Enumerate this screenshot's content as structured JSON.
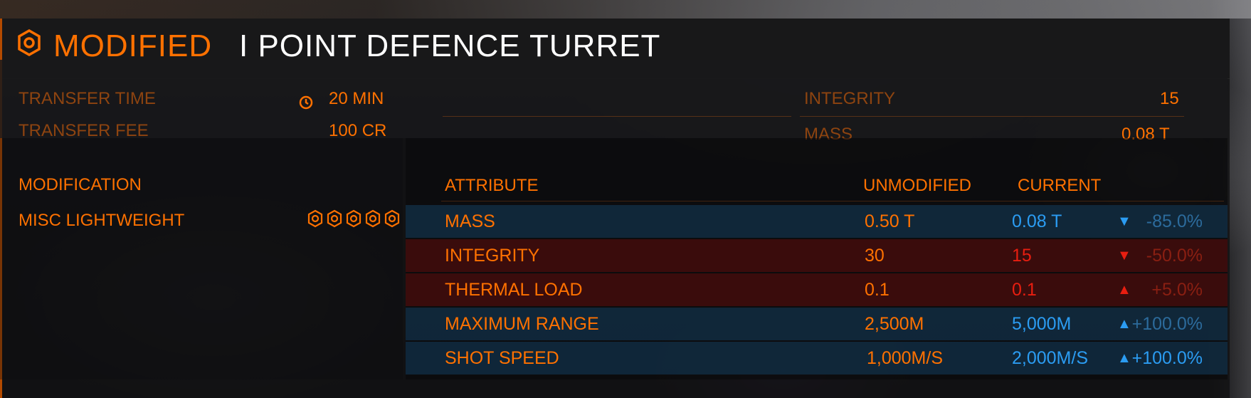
{
  "header": {
    "status": "MODIFIED",
    "title": "I POINT DEFENCE TURRET"
  },
  "transfer": {
    "time_label": "TRANSFER TIME",
    "time_value": "20 MIN",
    "fee_label": "TRANSFER FEE",
    "fee_value": "100 CR",
    "integrity_label": "INTEGRITY",
    "integrity_value": "15",
    "mass_label": "MASS",
    "mass_value": "0.08 T"
  },
  "modification": {
    "header": "MODIFICATION",
    "name": "MISC LIGHTWEIGHT",
    "grade": 5
  },
  "table": {
    "headers": {
      "attribute": "ATTRIBUTE",
      "unmodified": "UNMODIFIED",
      "current": "CURRENT"
    },
    "rows": [
      {
        "attribute": "MASS",
        "unmodified": "0.50 T",
        "current": "0.08 T",
        "arrow": "▼",
        "change": "-85.0%",
        "state": "good"
      },
      {
        "attribute": "INTEGRITY",
        "unmodified": "30",
        "current": "15",
        "arrow": "▼",
        "change": "-50.0%",
        "state": "bad"
      },
      {
        "attribute": "THERMAL LOAD",
        "unmodified": "0.1",
        "current": "0.1",
        "arrow": "▲",
        "change": "+5.0%",
        "state": "bad"
      },
      {
        "attribute": "MAXIMUM RANGE",
        "unmodified": "2,500M",
        "current": "5,000M",
        "arrow": "▲",
        "change": "+100.0%",
        "state": "good"
      },
      {
        "attribute": "SHOT SPEED",
        "unmodified": "1,000M/S",
        "current": "2,000M/S",
        "arrow": "▲",
        "change": "+100.0%",
        "state": "good"
      }
    ]
  },
  "colors": {
    "accent": "#ff7100",
    "good": "#2b9cf2",
    "bad": "#e81e10"
  },
  "icons": {
    "header": "hexagon-badge-icon",
    "time": "clock-icon",
    "grade": "blueprint-grade-icon"
  }
}
